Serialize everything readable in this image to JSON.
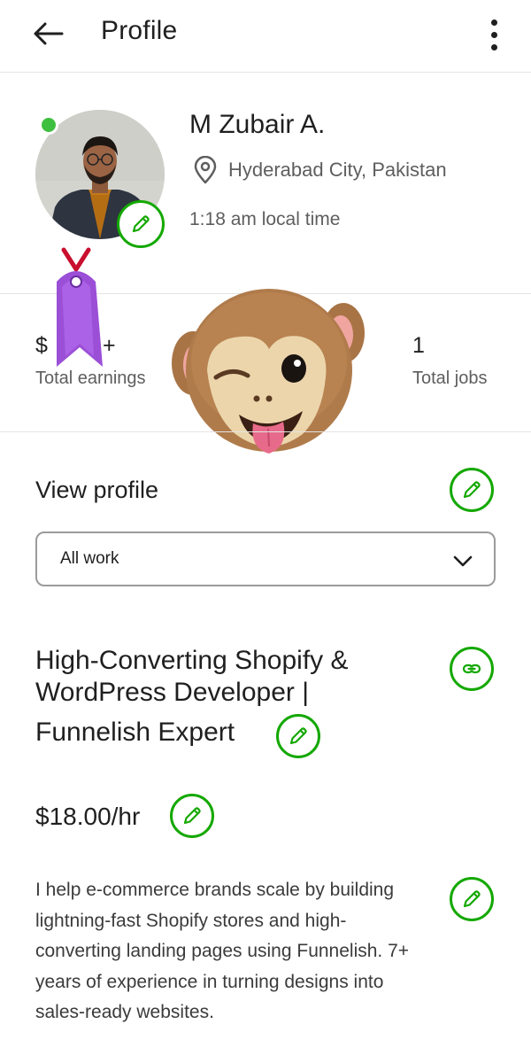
{
  "header": {
    "title": "Profile",
    "back_icon": "arrow-left-icon",
    "more_icon": "more-vertical-icon"
  },
  "profile": {
    "name": "M Zubair A.",
    "location": "Hyderabad City, Pakistan",
    "local_time": "1:18 am local time",
    "status": "online"
  },
  "stats": {
    "earnings_value_visible_left": "$",
    "earnings_value_visible_right": "+",
    "earnings_label": "Total earnings",
    "jobs_value": "1",
    "jobs_label": "Total jobs"
  },
  "view_profile": {
    "title": "View profile",
    "dropdown_selected": "All work"
  },
  "specialized_profile": {
    "headline": "High-Converting Shopify & WordPress Developer |",
    "headline_line3": "Funnelish Expert",
    "hourly_rate": "$18.00/hr",
    "overview": "I help e-commerce brands scale by building lightning-fast Shopify stores and high-converting landing pages using Funnelish. 7+ years of experience in turning designs into sales-ready websites."
  },
  "colors": {
    "accent_green": "#14a800",
    "online_green": "#3fbf3f",
    "text_primary": "#1f1f1f",
    "text_secondary": "#5e5e5e",
    "divider": "#e4e4e4"
  },
  "stickers": [
    "purple-tag-sticker",
    "winking-monkey-emoji"
  ]
}
